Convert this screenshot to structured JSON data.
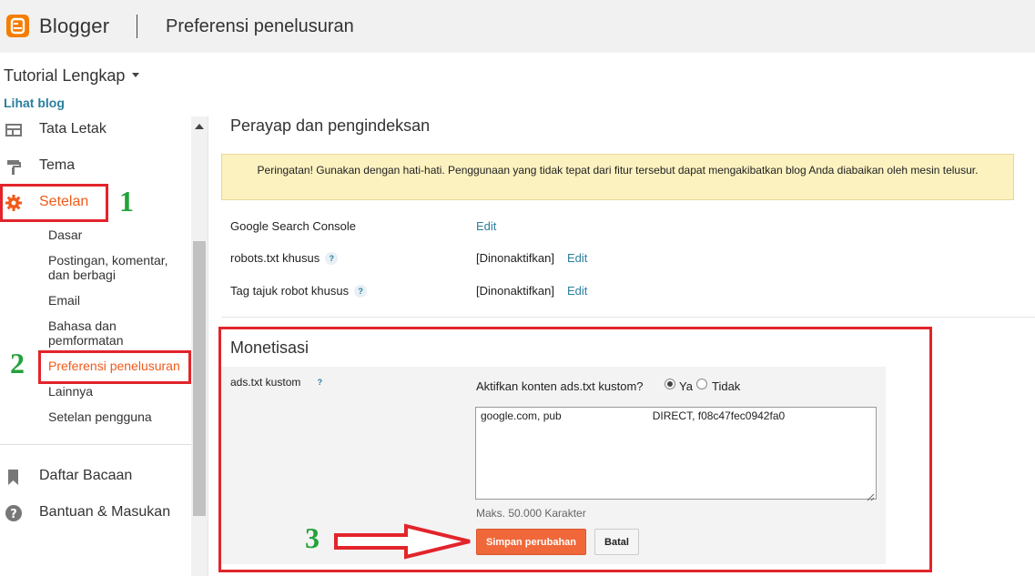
{
  "app": {
    "brand": "Blogger",
    "page_title": "Preferensi penelusuran",
    "accent": "#f57d00"
  },
  "blog": {
    "name": "Tutorial Lengkap",
    "view_link": "Lihat blog"
  },
  "sidebar": {
    "items": [
      {
        "label": "Tata Letak",
        "icon": "layout-icon"
      },
      {
        "label": "Tema",
        "icon": "paint-roller-icon"
      },
      {
        "label": "Setelan",
        "icon": "gear-icon"
      }
    ],
    "sub_items": [
      {
        "label": "Dasar"
      },
      {
        "label": "Postingan, komentar, dan berbagi"
      },
      {
        "label": "Email"
      },
      {
        "label": "Bahasa dan pemformatan"
      },
      {
        "label": "Preferensi penelusuran"
      },
      {
        "label": "Lainnya"
      },
      {
        "label": "Setelan pengguna"
      }
    ],
    "bottom_items": [
      {
        "label": "Daftar Bacaan",
        "icon": "bookmark-icon"
      },
      {
        "label": "Bantuan & Masukan",
        "icon": "help-circle-icon"
      }
    ]
  },
  "crawl": {
    "title": "Perayap dan pengindeksan",
    "warning": "Peringatan! Gunakan dengan hati-hati. Penggunaan yang tidak tepat dari fitur tersebut dapat mengakibatkan blog Anda diabaikan oleh mesin telusur.",
    "rows": [
      {
        "label": "Google Search Console",
        "value": "",
        "link": "Edit"
      },
      {
        "label": "robots.txt khusus",
        "value": "[Dinonaktifkan]",
        "link": "Edit"
      },
      {
        "label": "Tag tajuk robot khusus",
        "value": "[Dinonaktifkan]",
        "link": "Edit"
      }
    ],
    "help_glyph": "?"
  },
  "monetization": {
    "title": "Monetisasi",
    "ads_label": "ads.txt kustom",
    "question": "Aktifkan konten ads.txt kustom?",
    "option_yes": "Ya",
    "option_no": "Tidak",
    "selected": "Ya",
    "textarea_value": "google.com, pub                              DIRECT, f08c47fec0942fa0",
    "max_chars": "Maks. 50.000 Karakter",
    "save_label": "Simpan perubahan",
    "cancel_label": "Batal"
  },
  "annotations": {
    "num1": "1",
    "num2": "2",
    "num3": "3",
    "box_color": "#e2242b",
    "num_color": "#23a23a"
  }
}
